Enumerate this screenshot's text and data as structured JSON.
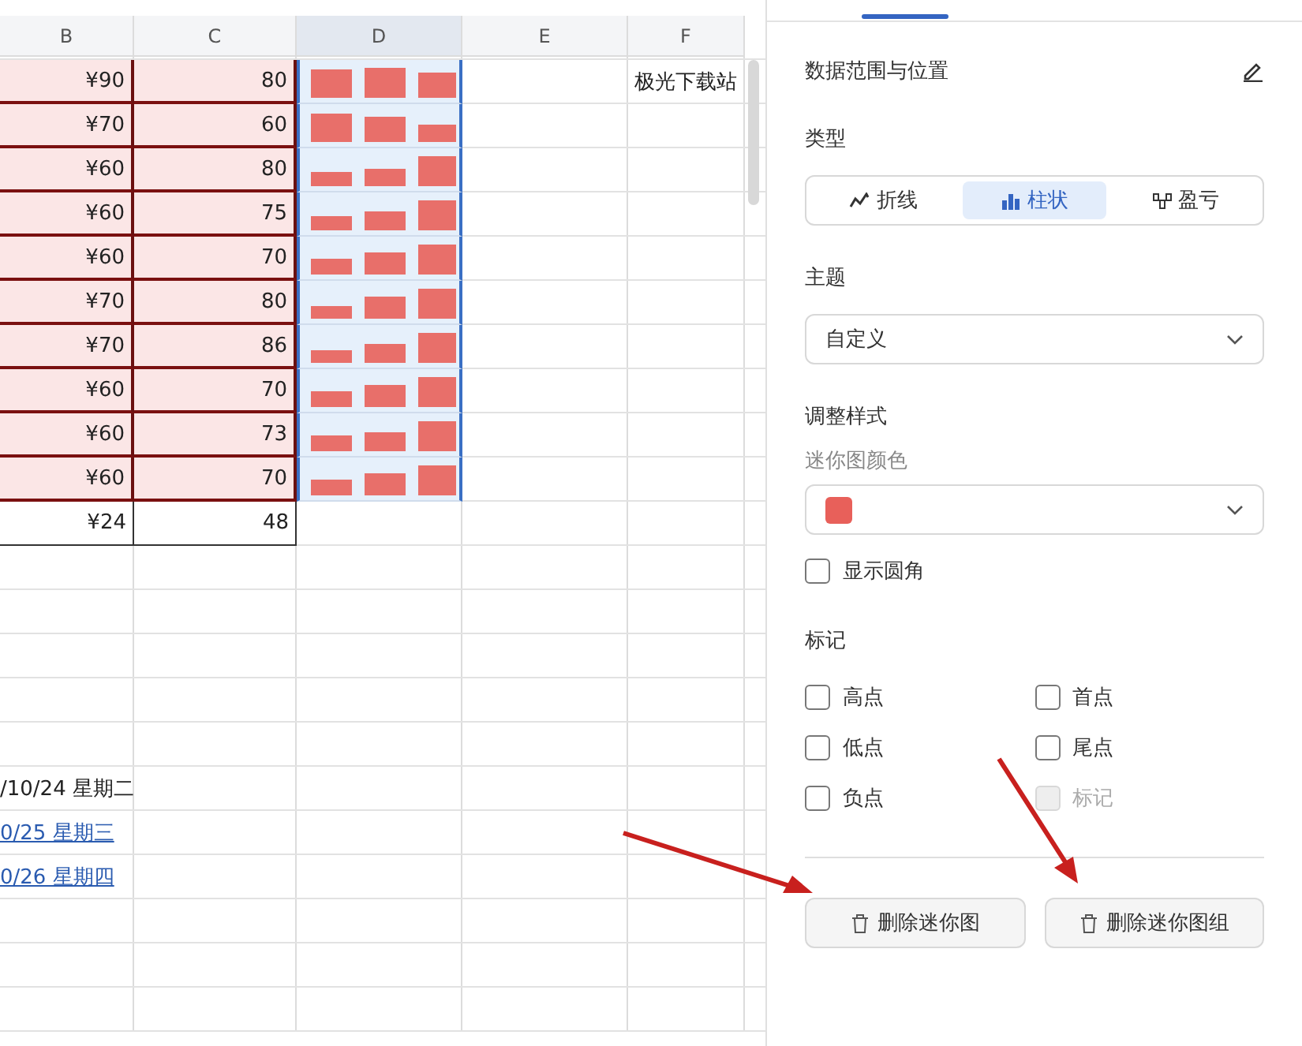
{
  "sheet": {
    "columns": [
      {
        "label": "B",
        "selected": false
      },
      {
        "label": "C",
        "selected": false
      },
      {
        "label": "D",
        "selected": true
      },
      {
        "label": "E",
        "selected": false
      },
      {
        "label": "F",
        "selected": false
      }
    ],
    "note": "极光下载站",
    "rows": [
      {
        "b": "¥90",
        "c": "80"
      },
      {
        "b": "¥70",
        "c": "60"
      },
      {
        "b": "¥60",
        "c": "80"
      },
      {
        "b": "¥60",
        "c": "75"
      },
      {
        "b": "¥60",
        "c": "70"
      },
      {
        "b": "¥70",
        "c": "80"
      },
      {
        "b": "¥70",
        "c": "86"
      },
      {
        "b": "¥60",
        "c": "70"
      },
      {
        "b": "¥60",
        "c": "73"
      },
      {
        "b": "¥60",
        "c": "70"
      }
    ],
    "total": {
      "b": "¥24",
      "c": "48"
    },
    "dates": [
      {
        "text": "/10/24 星期二",
        "link": false
      },
      {
        "text": "0/25 星期三",
        "link": true
      },
      {
        "text": "0/26 星期四",
        "link": true
      }
    ]
  },
  "panel": {
    "range_title": "数据范围与位置",
    "type_label": "类型",
    "types": [
      {
        "kind": "line",
        "label": "折线",
        "selected": false
      },
      {
        "kind": "column",
        "label": "柱状",
        "selected": true
      },
      {
        "kind": "winloss",
        "label": "盈亏",
        "selected": false
      }
    ],
    "theme_label": "主题",
    "theme_value": "自定义",
    "style_label": "调整样式",
    "color_label": "迷你图颜色",
    "color": "#e8605a",
    "rounded": {
      "label": "显示圆角",
      "checked": false
    },
    "markers_label": "标记",
    "markers": [
      {
        "label": "高点",
        "checked": false,
        "disabled": false
      },
      {
        "label": "首点",
        "checked": false,
        "disabled": false
      },
      {
        "label": "低点",
        "checked": false,
        "disabled": false
      },
      {
        "label": "尾点",
        "checked": false,
        "disabled": false
      },
      {
        "label": "负点",
        "checked": false,
        "disabled": false
      },
      {
        "label": "标记",
        "checked": false,
        "disabled": true
      }
    ],
    "buttons": [
      "删除迷你图",
      "删除迷你图组"
    ]
  }
}
